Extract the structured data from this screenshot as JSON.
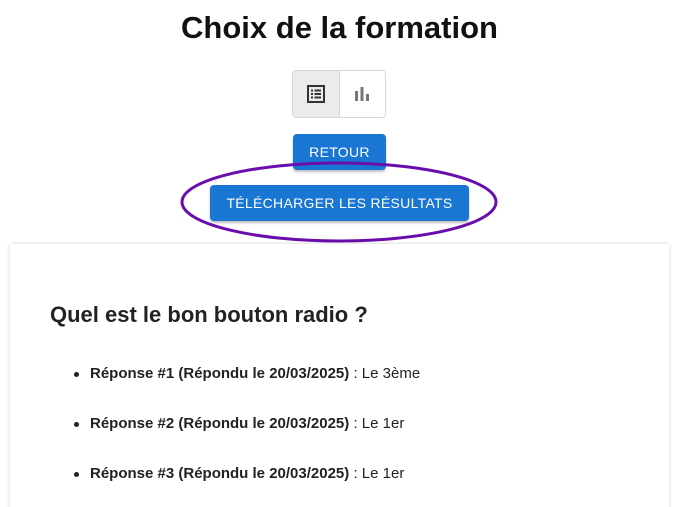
{
  "page": {
    "title": "Choix de la formation"
  },
  "view_toggle": {
    "list_icon": "list-icon",
    "chart_icon": "bar-chart-icon",
    "active": "list"
  },
  "buttons": {
    "back_label": "RETOUR",
    "download_label": "TÉLÉCHARGER LES RÉSULTATS"
  },
  "colors": {
    "primary": "#1976d2",
    "highlight": "#6a0dad"
  },
  "question": {
    "title": "Quel est le bon bouton radio ?",
    "answers": [
      {
        "label": "Réponse #1 (Répondu le 20/03/2025)",
        "value": "Le 3ème"
      },
      {
        "label": "Réponse #2 (Répondu le 20/03/2025)",
        "value": "Le 1er"
      },
      {
        "label": "Réponse #3 (Répondu le 20/03/2025)",
        "value": "Le 1er"
      }
    ]
  }
}
